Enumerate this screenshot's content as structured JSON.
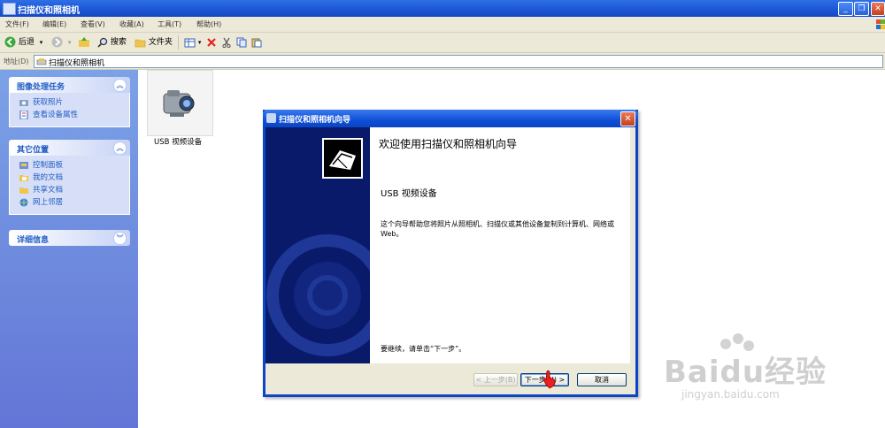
{
  "window": {
    "title": "扫描仪和照相机",
    "buttons": [
      "_",
      "❐",
      "✕"
    ]
  },
  "menu": [
    "文件(F)",
    "编辑(E)",
    "查看(V)",
    "收藏(A)",
    "工具(T)",
    "帮助(H)"
  ],
  "toolbar": {
    "back": "后退",
    "search": "搜索",
    "folders": "文件夹"
  },
  "address": {
    "label": "地址(D)",
    "value": "扫描仪和照相机"
  },
  "sidebar": {
    "tasks": {
      "title": "图像处理任务",
      "items": [
        "获取照片",
        "查看设备属性"
      ]
    },
    "places": {
      "title": "其它位置",
      "items": [
        "控制面板",
        "我的文档",
        "共享文档",
        "网上邻居"
      ]
    },
    "details": {
      "title": "详细信息"
    }
  },
  "device": {
    "label": "USB 视频设备"
  },
  "wizard": {
    "title": "扫描仪和照相机向导",
    "heading": "欢迎使用扫描仪和照相机向导",
    "device": "USB 视频设备",
    "description": "这个向导帮助您将照片从照相机、扫描仪或其他设备复制到计算机、网络或 Web。",
    "continue": "要继续，请单击“下一步”。",
    "back_button": "< 上一步(B)",
    "next_button": "下一步(N) >",
    "cancel_button": "取消"
  },
  "watermark": {
    "brand": "Baidu经验",
    "url": "jingyan.baidu.com"
  },
  "colors": {
    "xp_blue": "#0b45c9",
    "panel_title": "#215dc6",
    "wizard_banner": "#0a1a6b"
  }
}
